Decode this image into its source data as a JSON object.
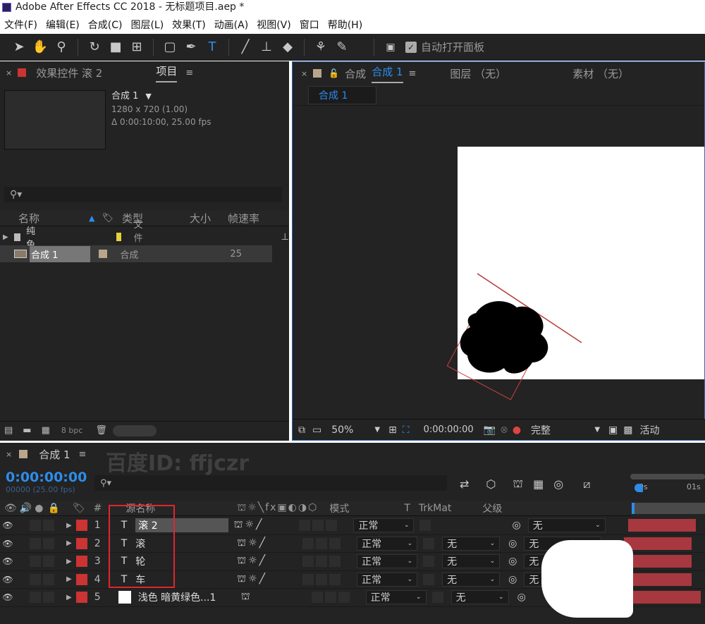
{
  "titlebar": {
    "title": "Adobe After Effects CC 2018 - 无标题项目.aep *"
  },
  "menu": [
    "文件(F)",
    "编辑(E)",
    "合成(C)",
    "图层(L)",
    "效果(T)",
    "动画(A)",
    "视图(V)",
    "窗口",
    "帮助(H)"
  ],
  "toolbar": {
    "auto_open_label": "自动打开面板",
    "auto_open_checked": true
  },
  "left_panel": {
    "tab_effects": "效果控件 滚 2",
    "tab_project": "项目",
    "comp_name": "合成 1",
    "comp_res": "1280 x 720 (1.00)",
    "comp_dur": "Δ 0:00:10:00, 25.00 fps",
    "search_placeholder": "",
    "columns": {
      "name": "名称",
      "type": "类型",
      "size": "大小",
      "fps": "帧速率"
    },
    "items": [
      {
        "name": "纯色",
        "type": "文件夹",
        "fps": "",
        "color": "#e6d23a"
      },
      {
        "name": "合成 1",
        "type": "合成",
        "fps": "25",
        "color": "#b9a58a"
      }
    ],
    "bpc": "8 bpc"
  },
  "viewer": {
    "tab_comp_prefix": "合成",
    "tab_comp_name": "合成 1",
    "tab_layer": "图层 （无）",
    "tab_footage": "素材 （无）",
    "subtab": "合成 1",
    "zoom": "50%",
    "timecode": "0:00:00:00",
    "quality": "完整",
    "active_cam": "活动"
  },
  "timeline": {
    "tab": "合成 1",
    "timecode": "0:00:00:00",
    "frames": "00000 (25.00 fps)",
    "search_placeholder": "",
    "col_num": "#",
    "col_source": "源名称",
    "col_mode": "模式",
    "col_t": "T",
    "col_trkmat": "TrkMat",
    "col_parent": "父级",
    "ruler": [
      "0s",
      "01s"
    ],
    "layers": [
      {
        "num": "1",
        "icon": "T",
        "name": "滚 2",
        "mode": "正常",
        "trkmat": "",
        "parent": "无",
        "color": "#c33"
      },
      {
        "num": "2",
        "icon": "T",
        "name": "滚",
        "mode": "正常",
        "trkmat": "无",
        "parent": "无",
        "color": "#c33"
      },
      {
        "num": "3",
        "icon": "T",
        "name": "轮",
        "mode": "正常",
        "trkmat": "无",
        "parent": "无",
        "color": "#c33"
      },
      {
        "num": "4",
        "icon": "T",
        "name": "车",
        "mode": "正常",
        "trkmat": "无",
        "parent": "无",
        "color": "#c33"
      },
      {
        "num": "5",
        "icon": "",
        "name": "浅色 暗黄绿色...1",
        "mode": "正常",
        "trkmat": "无",
        "parent": "",
        "color": "#c33"
      }
    ]
  },
  "watermark": "百度ID: ffjczr"
}
